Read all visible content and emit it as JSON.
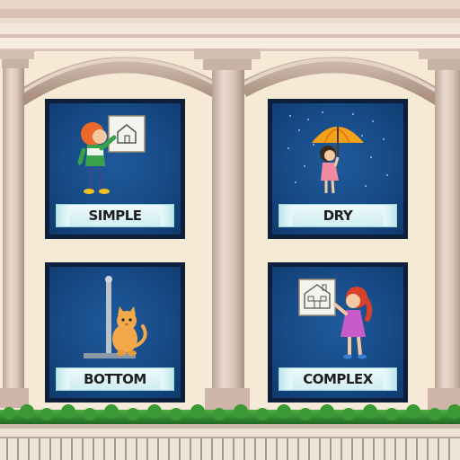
{
  "cards": [
    {
      "label": "SIMPLE"
    },
    {
      "label": "DRY"
    },
    {
      "label": "BOTTOM"
    },
    {
      "label": "COMPLEX"
    }
  ],
  "colors": {
    "wall": "#f6ead6",
    "column": "#d7c3b6",
    "card_frame": "#0d1f3b",
    "card_bg": "#174a86",
    "label_bg": "#dff4f6",
    "hedge": "#2f8a2f"
  }
}
